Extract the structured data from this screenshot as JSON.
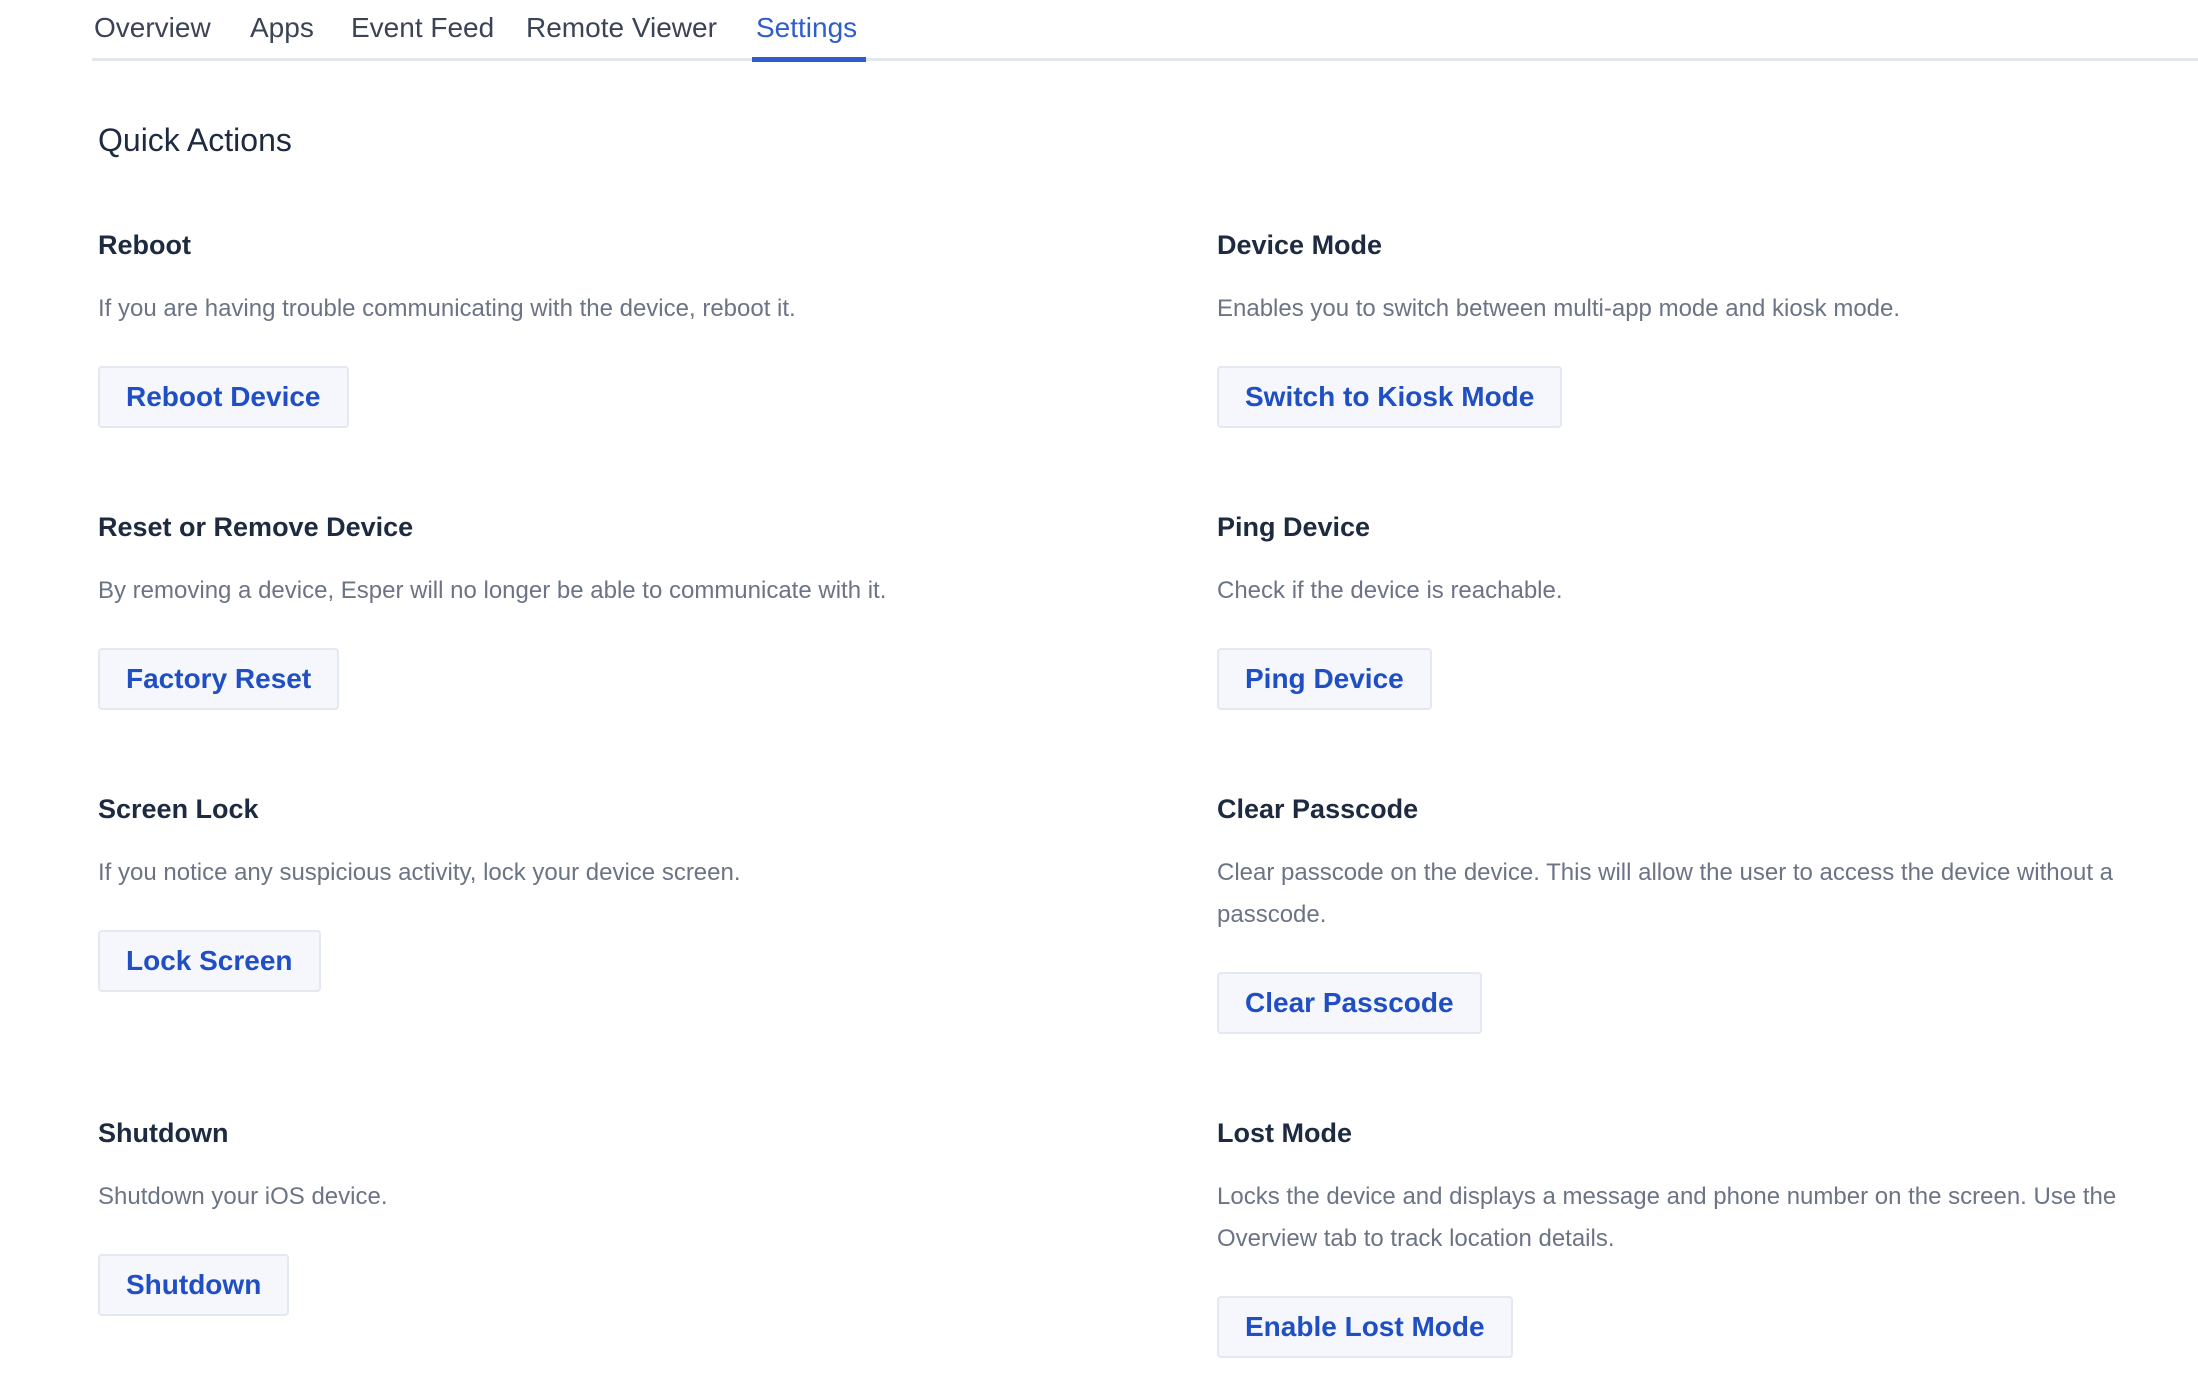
{
  "tabs": [
    {
      "label": "Overview",
      "active": false
    },
    {
      "label": "Apps",
      "active": false
    },
    {
      "label": "Event Feed",
      "active": false
    },
    {
      "label": "Remote Viewer",
      "active": false
    },
    {
      "label": "Settings",
      "active": true
    }
  ],
  "quick_actions": {
    "title": "Quick Actions",
    "items": [
      {
        "title": "Reboot",
        "description": "If you are having trouble communicating with the device, reboot it.",
        "button": "Reboot Device"
      },
      {
        "title": "Device Mode",
        "description": "Enables you to switch between multi-app mode and kiosk mode.",
        "button": "Switch to Kiosk Mode"
      },
      {
        "title": "Reset or Remove Device",
        "description": "By removing a device, Esper will no longer be able to communicate with it.",
        "button": "Factory Reset"
      },
      {
        "title": "Ping Device",
        "description": "Check if the device is reachable.",
        "button": "Ping Device"
      },
      {
        "title": "Screen Lock",
        "description": "If you notice any suspicious activity, lock your device screen.",
        "button": "Lock Screen"
      },
      {
        "title": "Clear Passcode",
        "description": "Clear passcode on the device. This will allow the user to access the device without a passcode.",
        "button": "Clear Passcode"
      },
      {
        "title": "Shutdown",
        "description": "Shutdown your iOS device.",
        "button": "Shutdown"
      },
      {
        "title": "Lost Mode",
        "description": "Locks the device and displays a message and phone number on the screen. Use the Overview tab to track location details.",
        "button": "Enable Lost Mode"
      }
    ]
  },
  "colors": {
    "accent": "#2f5dcc",
    "button_text": "#1f4fc2",
    "heading": "#1e2a40",
    "muted_text": "#6b7485"
  }
}
